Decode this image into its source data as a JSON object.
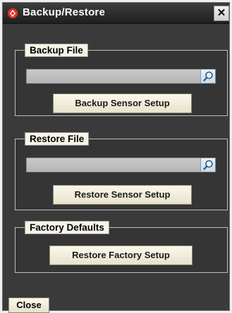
{
  "window": {
    "title": "Backup/Restore",
    "close_glyph": "✕",
    "app_icon": "app-logo-icon",
    "accent_color": "#e0341f"
  },
  "backup": {
    "legend": "Backup File",
    "path_value": "",
    "browse_icon": "magnifier-icon",
    "button_label": "Backup Sensor Setup"
  },
  "restore": {
    "legend": "Restore File",
    "path_value": "",
    "browse_icon": "magnifier-icon",
    "button_label": "Restore Sensor Setup"
  },
  "factory": {
    "legend": "Factory Defaults",
    "button_label": "Restore Factory Setup"
  },
  "footer": {
    "close_label": "Close"
  }
}
